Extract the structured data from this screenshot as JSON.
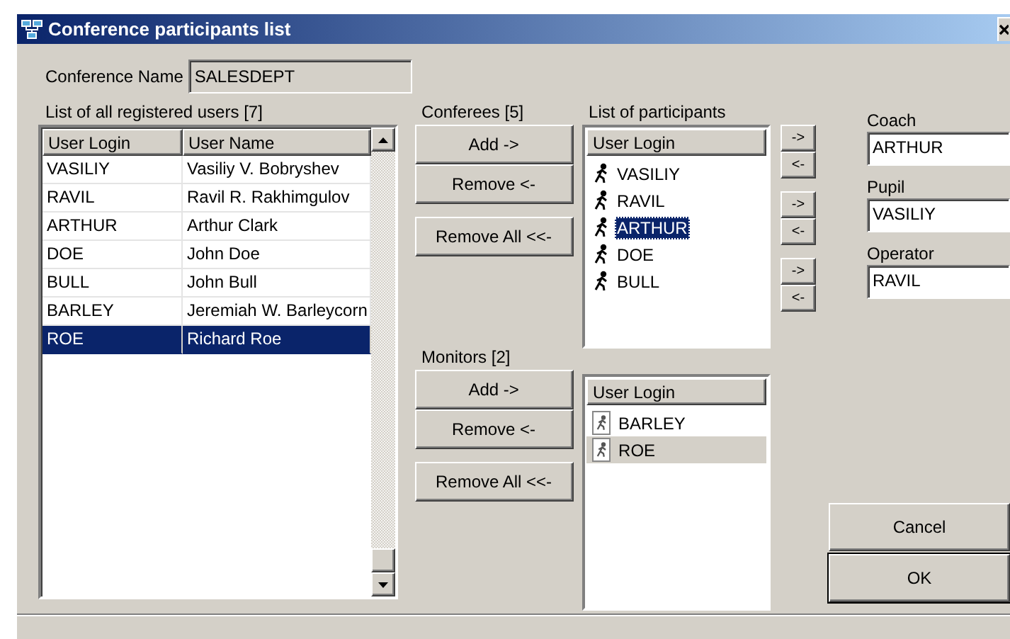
{
  "window": {
    "title": "Conference participants list"
  },
  "conference_name": {
    "label": "Conference Name",
    "value": "SALESDEPT"
  },
  "users": {
    "label": "List of all registered users [7]",
    "columns": [
      "User Login",
      "User Name"
    ],
    "rows": [
      {
        "login": "VASILIY",
        "name": "Vasiliy V. Bobryshev",
        "selected": false
      },
      {
        "login": "RAVIL",
        "name": "Ravil R. Rakhimgulov",
        "selected": false
      },
      {
        "login": "ARTHUR",
        "name": "Arthur Clark",
        "selected": false
      },
      {
        "login": "DOE",
        "name": "John Doe",
        "selected": false
      },
      {
        "login": "BULL",
        "name": "John Bull",
        "selected": false
      },
      {
        "login": "BARLEY",
        "name": "Jeremiah  W. Barleycorn",
        "selected": false
      },
      {
        "login": "ROE",
        "name": "Richard Roe",
        "selected": true
      }
    ]
  },
  "conferees": {
    "label": "Conferees [5]",
    "buttons": [
      "Add ->",
      "Remove <-",
      "Remove All <<-"
    ]
  },
  "participants": {
    "label": "List of participants",
    "column": "User Login",
    "focused": true,
    "items": [
      {
        "login": "VASILIY",
        "kind": "conferee",
        "selected": false
      },
      {
        "login": "RAVIL",
        "kind": "conferee",
        "selected": false
      },
      {
        "login": "ARTHUR",
        "kind": "conferee",
        "selected": true
      },
      {
        "login": "DOE",
        "kind": "conferee",
        "selected": false
      },
      {
        "login": "BULL",
        "kind": "conferee",
        "selected": false
      }
    ]
  },
  "monitors": {
    "label": "Monitors [2]",
    "buttons": [
      "Add ->",
      "Remove <-",
      "Remove All <<-"
    ],
    "column": "User Login",
    "focused": false,
    "items": [
      {
        "login": "BARLEY",
        "kind": "monitor",
        "selected": false
      },
      {
        "login": "ROE",
        "kind": "monitor",
        "selected": true
      }
    ]
  },
  "roles": [
    {
      "label": "Coach",
      "value": "ARTHUR",
      "buttons": [
        "->",
        "<-"
      ]
    },
    {
      "label": "Pupil",
      "value": "VASILIY",
      "buttons": [
        "->",
        "<-"
      ]
    },
    {
      "label": "Operator",
      "value": "RAVIL",
      "buttons": [
        "->",
        "<-"
      ]
    }
  ],
  "buttons": [
    {
      "label": "Cancel",
      "default": false
    },
    {
      "label": "OK",
      "default": true
    }
  ]
}
